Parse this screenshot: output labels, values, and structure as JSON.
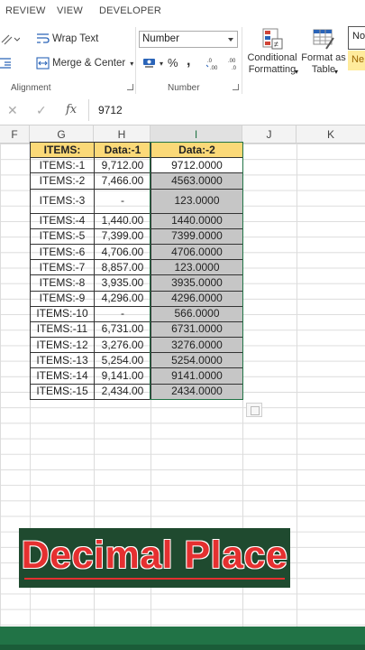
{
  "ribbon_tabs": [
    "REVIEW",
    "VIEW",
    "DEVELOPER"
  ],
  "ribbon": {
    "wrap_text": "Wrap Text",
    "merge_center": "Merge & Center",
    "alignment_label": "Alignment",
    "number_format": "Number",
    "currency_symbol": "$",
    "percent_symbol": "%",
    "comma_symbol": ",",
    "increase_decimal": ".00→.0",
    "decrease_decimal": ".0→.00",
    "number_label": "Number",
    "conditional_formatting_line1": "Conditional",
    "conditional_formatting_line2": "Formatting",
    "format_as_table_line1": "Format as",
    "format_as_table_line2": "Table",
    "style_normal": "No",
    "style_neutral": "Ne"
  },
  "formula_bar": {
    "cancel": "✕",
    "enter": "✓",
    "fx": "fx",
    "value": "9712"
  },
  "columns": [
    "F",
    "G",
    "H",
    "I",
    "J",
    "K"
  ],
  "table": {
    "headers": [
      "ITEMS:",
      "Data:-1",
      "Data:-2"
    ],
    "rows": [
      [
        "ITEMS:-1",
        "9,712.00",
        "9712.0000"
      ],
      [
        "ITEMS:-2",
        "7,466.00",
        "4563.0000"
      ],
      [
        "ITEMS:-3",
        "-",
        "123.0000"
      ],
      [
        "ITEMS:-4",
        "1,440.00",
        "1440.0000"
      ],
      [
        "ITEMS:-5",
        "7,399.00",
        "7399.0000"
      ],
      [
        "ITEMS:-6",
        "4,706.00",
        "4706.0000"
      ],
      [
        "ITEMS:-7",
        "8,857.00",
        "123.0000"
      ],
      [
        "ITEMS:-8",
        "3,935.00",
        "3935.0000"
      ],
      [
        "ITEMS:-9",
        "4,296.00",
        "4296.0000"
      ],
      [
        "ITEMS:-10",
        "-",
        "566.0000"
      ],
      [
        "ITEMS:-11",
        "6,731.00",
        "6731.0000"
      ],
      [
        "ITEMS:-12",
        "3,276.00",
        "3276.0000"
      ],
      [
        "ITEMS:-13",
        "5,254.00",
        "5254.0000"
      ],
      [
        "ITEMS:-14",
        "9,141.00",
        "9141.0000"
      ],
      [
        "ITEMS:-15",
        "2,434.00",
        "2434.0000"
      ]
    ]
  },
  "banner": {
    "text": "Decimal Place"
  },
  "colors": {
    "excel_green": "#217346",
    "header_fill": "#fbd978",
    "selection_fill": "#c6c6c6",
    "banner_bg": "#1f4a2f",
    "banner_text": "#e53030"
  }
}
